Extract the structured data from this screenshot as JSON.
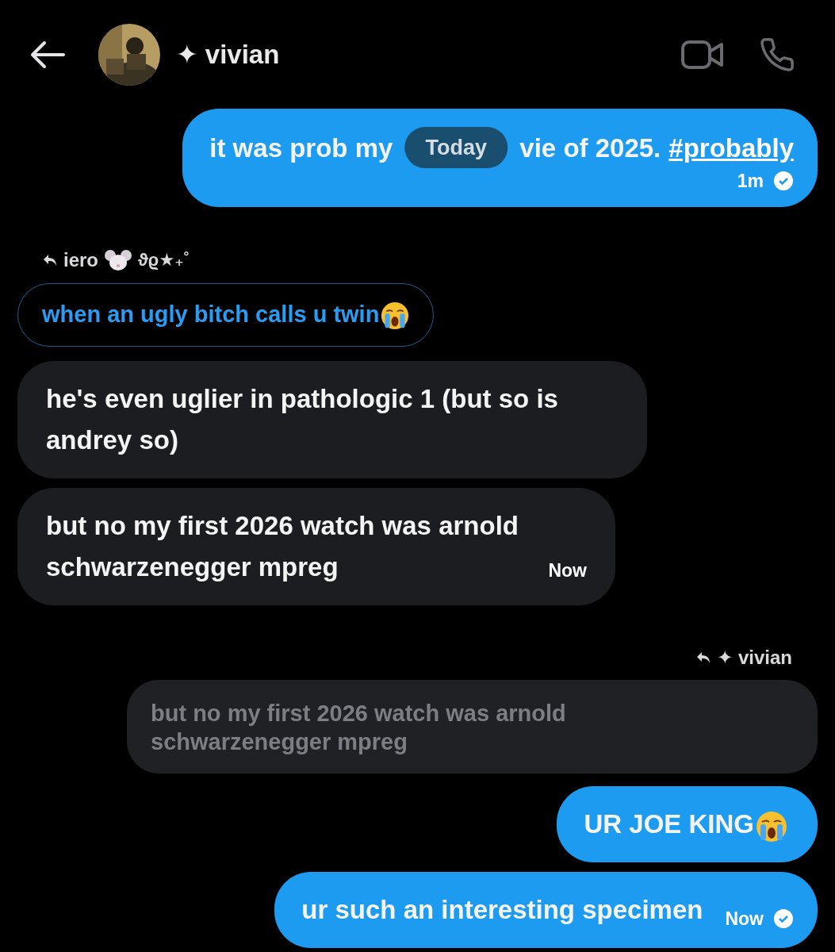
{
  "header": {
    "title": "✦ vivian"
  },
  "date_pill": "Today",
  "messages": [
    {
      "kind": "sent",
      "segments": [
        "it was prob my",
        "vie of 2025."
      ],
      "link": "#probably",
      "time": "1m",
      "seen": true
    },
    {
      "kind": "reply_label_in",
      "name": "iero",
      "decoration": "ϑϱ★₊˚",
      "mouse_icon": true
    },
    {
      "kind": "quote_in",
      "text": "when an ugly bitch calls u twin",
      "trailing_icon": true
    },
    {
      "kind": "received",
      "text": "he's even uglier in pathologic 1 (but so is andrey so)"
    },
    {
      "kind": "received",
      "text": "but no my first 2026 watch was arnold schwarzenegger mpreg",
      "time": "Now"
    },
    {
      "kind": "reply_label_out",
      "name": "✦ vivian"
    },
    {
      "kind": "quote_out",
      "text": "but no my first 2026 watch was arnold schwarzenegger mpreg"
    },
    {
      "kind": "sent",
      "segments": [
        "UR JOE KING"
      ],
      "trailing_icon": true
    },
    {
      "kind": "sent",
      "segments": [
        "ur such an interesting specimen"
      ],
      "time": "Now",
      "seen": true
    }
  ]
}
